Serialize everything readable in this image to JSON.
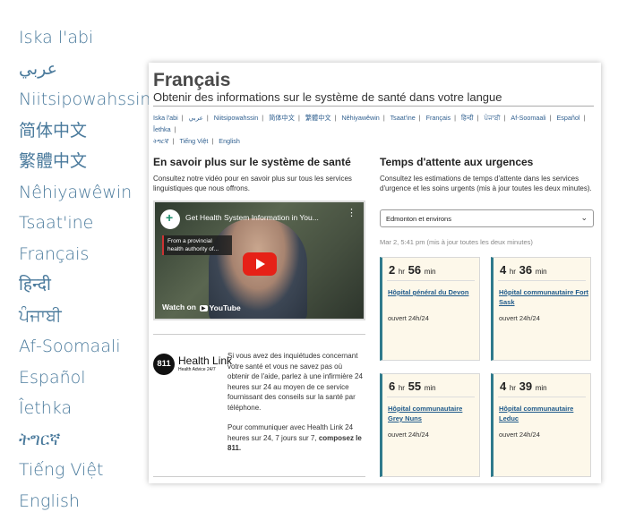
{
  "languages": [
    "Iska l'abi",
    "عربي",
    "Niitsipowahssin",
    "简体中文",
    "繁體中文",
    "Nêhiyawêwin",
    "Tsaat'ine",
    "Français",
    "हिन्दी",
    "ਪੰਜਾਬੀ",
    "Af-Soomaali",
    "Español",
    "Îethka",
    "ትግርኛ",
    "Tiếng Việt",
    "English"
  ],
  "page": {
    "title": "Français",
    "subtitle": "Obtenir des informations sur le système de santé dans votre langue",
    "nav_langs": [
      "Iska l'abi",
      "عربي",
      "Niitsipowahssin",
      "简体中文",
      "繁體中文",
      "Nêhiyawêwin",
      "Tsaat'ine",
      "Français",
      "हिन्दी",
      "ਪੰਜਾਬੀ",
      "Af-Soomaali",
      "Español",
      "Îethka",
      "ትግርኛ",
      "Tiếng Việt",
      "English"
    ]
  },
  "learn": {
    "heading": "En savoir plus sur le système de santé",
    "text": "Consultez notre vidéo pour en savoir plus sur tous les services linguistiques que nous offrons."
  },
  "video": {
    "title": "Get Health System Information in You...",
    "chip": "From a provincial health authority of...",
    "watch_on": "Watch on",
    "youtube": "YouTube"
  },
  "healthlink": {
    "badge": "811",
    "name": "Health Link",
    "tagline": "Health Advice 24/7",
    "p1": "Si vous avez des inquiétudes concernant votre santé et vous ne savez pas où obtenir de l'aide, parlez à une infirmière 24 heures sur 24 au moyen de ce service fournissant des conseils sur la santé par téléphone.",
    "p2_start": "Pour communiquer avec Health Link 24 heures sur 24, 7 jours sur 7, ",
    "p2_bold": "composez le 811."
  },
  "wait": {
    "heading": "Temps d'attente aux urgences",
    "text": "Consultez les estimations de temps d'attente dans les services d'urgence et les soins urgents (mis à jour toutes les deux minutes).",
    "region": "Edmonton et environs",
    "updated": "Mar 2, 5:41 pm (mis à jour toutes les deux minutes)",
    "hr_unit": "hr",
    "min_unit": "min",
    "cards": [
      {
        "hours": "2",
        "mins": "56",
        "hospital": "Hôpital général du Devon",
        "hours_text": "ouvert 24h/24"
      },
      {
        "hours": "4",
        "mins": "36",
        "hospital": "Hôpital communautaire Fort Sask",
        "hours_text": "ouvert 24h/24"
      },
      {
        "hours": "6",
        "mins": "55",
        "hospital": "Hôpital communautaire Grey Nuns",
        "hours_text": "ouvert 24h/24"
      },
      {
        "hours": "4",
        "mins": "39",
        "hospital": "Hôpital communautaire Leduc",
        "hours_text": "ouvert 24h/24"
      }
    ]
  }
}
